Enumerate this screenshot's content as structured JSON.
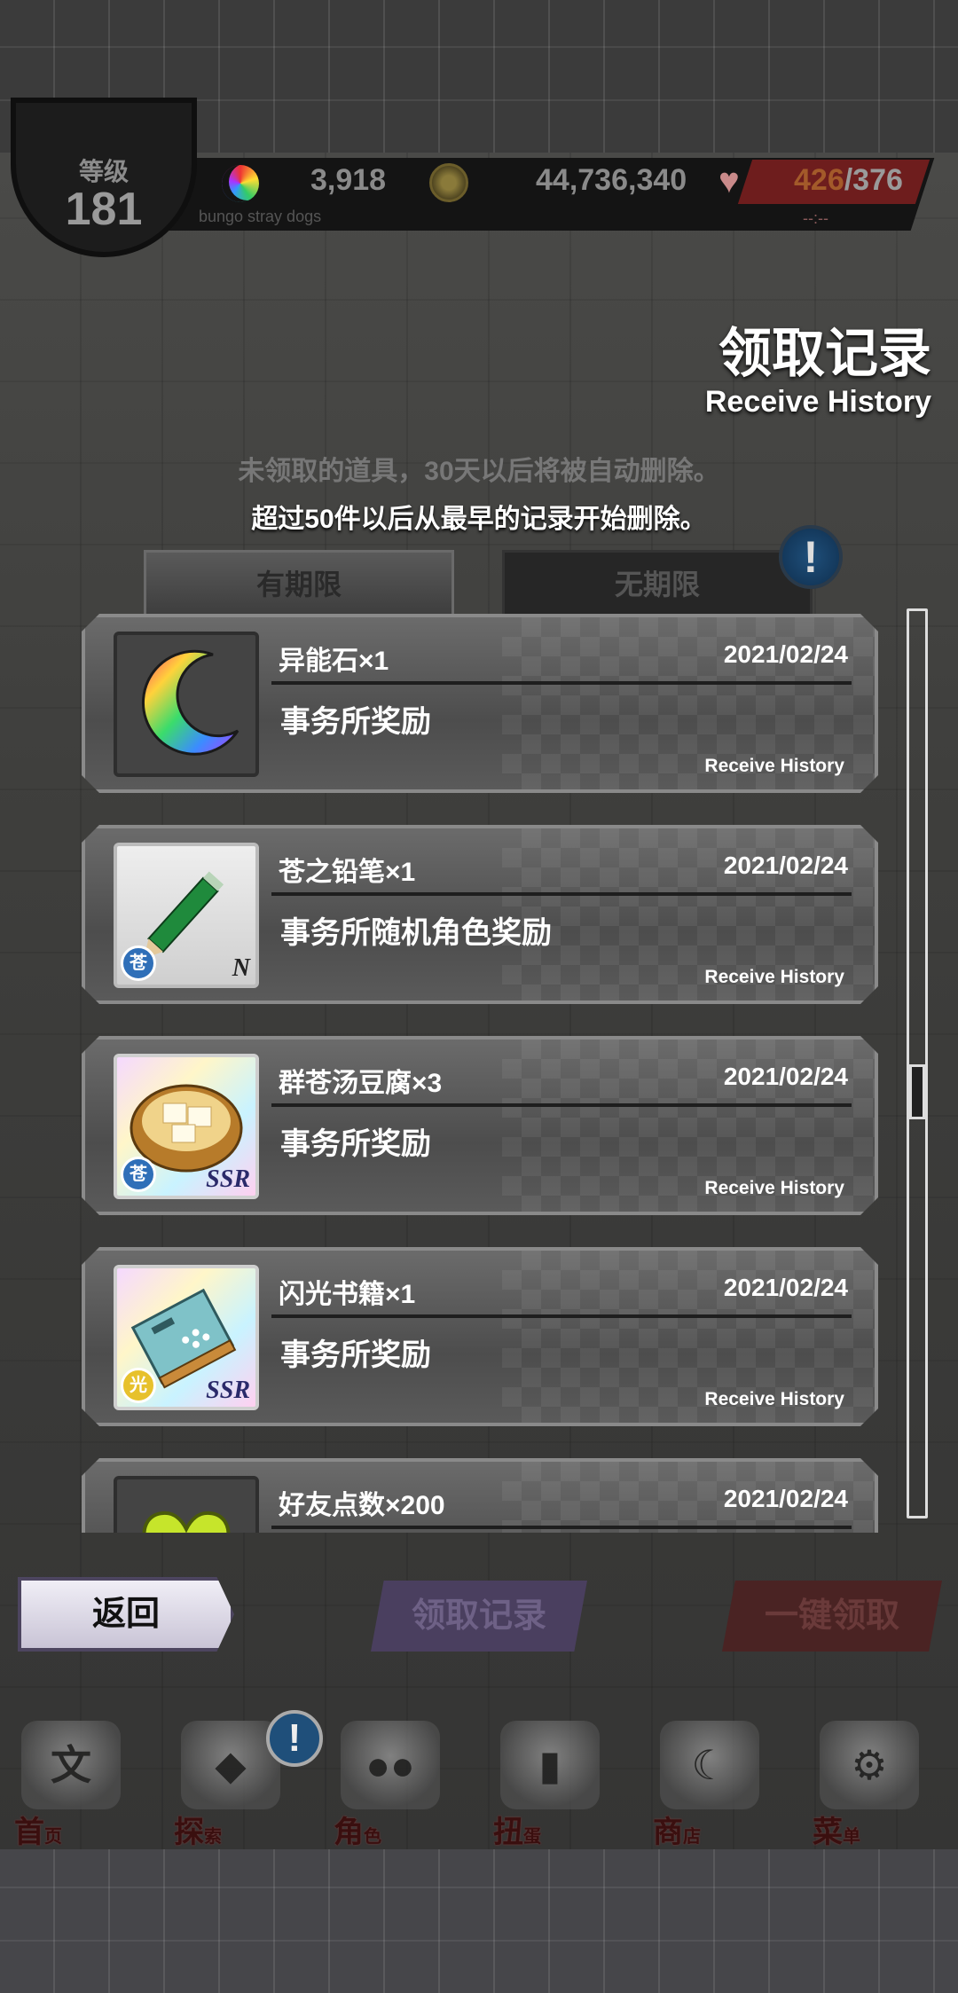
{
  "status": {
    "level_label": "等级",
    "level_value": "181",
    "stones": "3,918",
    "coins": "44,736,340",
    "stamina_current": "426",
    "stamina_max": "/376",
    "stamina_sub": "--:--",
    "caption": "bungo stray dogs"
  },
  "header": {
    "title": "领取记录",
    "subtitle": "Receive History",
    "notice_line1": "未领取的道具，30天以后将被自动删除。",
    "notice_line2": "超过50件以后从最早的记录开始删除。"
  },
  "tabs": [
    {
      "label": "有期限"
    },
    {
      "label": "无期限"
    }
  ],
  "alert": "!",
  "records": [
    {
      "name": "异能石×1",
      "date": "2021/02/24",
      "desc": "事务所奖励",
      "tag": "Receive History"
    },
    {
      "name": "苍之铅笔×1",
      "date": "2021/02/24",
      "desc": "事务所随机角色奖励",
      "tag": "Receive History",
      "rarity": "N",
      "attr": "苍"
    },
    {
      "name": "群苍汤豆腐×3",
      "date": "2021/02/24",
      "desc": "事务所奖励",
      "tag": "Receive History",
      "rarity": "SSR",
      "attr": "苍"
    },
    {
      "name": "闪光书籍×1",
      "date": "2021/02/24",
      "desc": "事务所奖励",
      "tag": "Receive History",
      "rarity": "SSR",
      "attr": "光"
    },
    {
      "name": "好友点数×200",
      "date": "2021/02/24"
    }
  ],
  "buttons": {
    "back": "返回",
    "history": "领取记录",
    "claim_all": "一键领取"
  },
  "nav": [
    {
      "label": "首",
      "small": "页",
      "icon": "文",
      "icon_name": "home-icon"
    },
    {
      "label": "探",
      "small": "索",
      "icon": "◆",
      "icon_name": "explore-icon"
    },
    {
      "label": "角",
      "small": "色",
      "icon": "●●",
      "icon_name": "characters-icon"
    },
    {
      "label": "扭",
      "small": "蛋",
      "icon": "▮",
      "icon_name": "gacha-icon"
    },
    {
      "label": "商",
      "small": "店",
      "icon": "☾",
      "icon_name": "shop-icon"
    },
    {
      "label": "菜",
      "small": "单",
      "icon": "⚙",
      "icon_name": "menu-icon"
    }
  ],
  "nav_badge": "!"
}
